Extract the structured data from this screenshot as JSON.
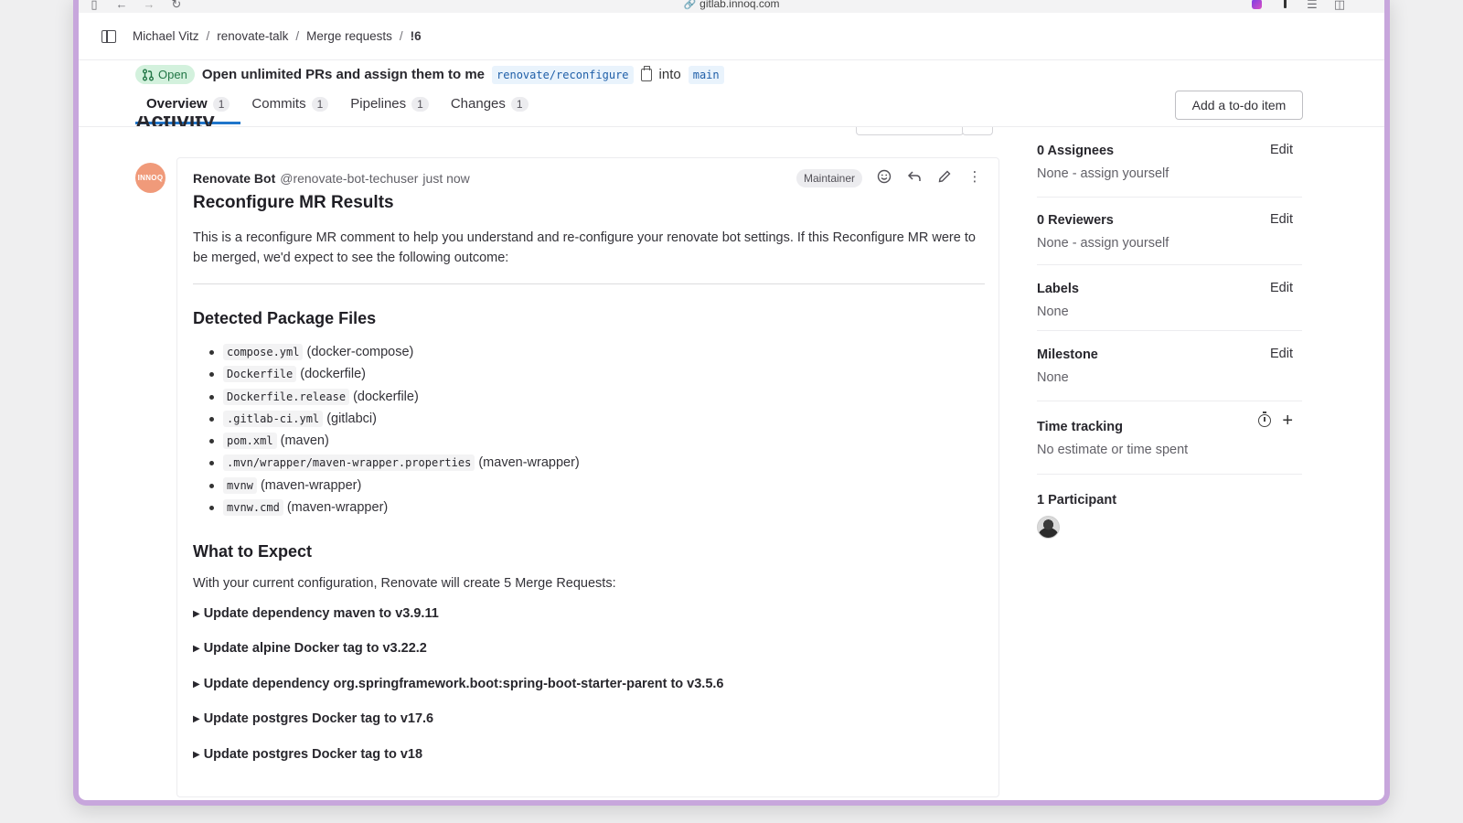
{
  "browser": {
    "url": "gitlab.innoq.com"
  },
  "breadcrumb": [
    "Michael Vitz",
    "renovate-talk",
    "Merge requests",
    "!6"
  ],
  "mr": {
    "status": "Open",
    "title": "Open unlimited PRs and assign them to me",
    "source_branch": "renovate/reconfigure",
    "into_label": "into",
    "target_branch": "main",
    "tabs": [
      {
        "label": "Overview",
        "count": "1",
        "active": true
      },
      {
        "label": "Commits",
        "count": "1"
      },
      {
        "label": "Pipelines",
        "count": "1"
      },
      {
        "label": "Changes",
        "count": "1"
      }
    ],
    "todo_button": "Add a to-do item",
    "activity_heading": "Activity"
  },
  "note": {
    "avatar_text": "INNOQ",
    "author": "Renovate Bot",
    "handle": "@renovate-bot-techuser",
    "time": "just now",
    "role": "Maintainer",
    "heading": "Reconfigure MR Results",
    "intro": "This is a reconfigure MR comment to help you understand and re-configure your renovate bot settings. If this Reconfigure MR were to be merged, we'd expect to see the following outcome:",
    "detected_heading": "Detected Package Files",
    "files": [
      {
        "file": "compose.yml",
        "type": "(docker-compose)"
      },
      {
        "file": "Dockerfile",
        "type": "(dockerfile)"
      },
      {
        "file": "Dockerfile.release",
        "type": "(dockerfile)"
      },
      {
        "file": ".gitlab-ci.yml",
        "type": "(gitlabci)"
      },
      {
        "file": "pom.xml",
        "type": "(maven)"
      },
      {
        "file": ".mvn/wrapper/maven-wrapper.properties",
        "type": "(maven-wrapper)"
      },
      {
        "file": "mvnw",
        "type": "(maven-wrapper)"
      },
      {
        "file": "mvnw.cmd",
        "type": "(maven-wrapper)"
      }
    ],
    "expect_heading": "What to Expect",
    "expect_text": "With your current configuration, Renovate will create 5 Merge Requests:",
    "updates": [
      "Update dependency maven to v3.9.11",
      "Update alpine Docker tag to v3.22.2",
      "Update dependency org.springframework.boot:spring-boot-starter-parent to v3.5.6",
      "Update postgres Docker tag to v17.6",
      "Update postgres Docker tag to v18"
    ]
  },
  "sidebar": {
    "assignees": {
      "title": "0 Assignees",
      "edit": "Edit",
      "value": "None - assign yourself"
    },
    "reviewers": {
      "title": "0 Reviewers",
      "edit": "Edit",
      "value": "None - assign yourself"
    },
    "labels": {
      "title": "Labels",
      "edit": "Edit",
      "value": "None"
    },
    "milestone": {
      "title": "Milestone",
      "edit": "Edit",
      "value": "None"
    },
    "time_tracking": {
      "title": "Time tracking",
      "value": "No estimate or time spent"
    },
    "participants": {
      "title": "1 Participant"
    }
  },
  "colors": {
    "accent": "#1f75cb",
    "open_badge_bg": "#d3f1dd",
    "open_badge_fg": "#217645",
    "frame": "#c7a6dc"
  }
}
